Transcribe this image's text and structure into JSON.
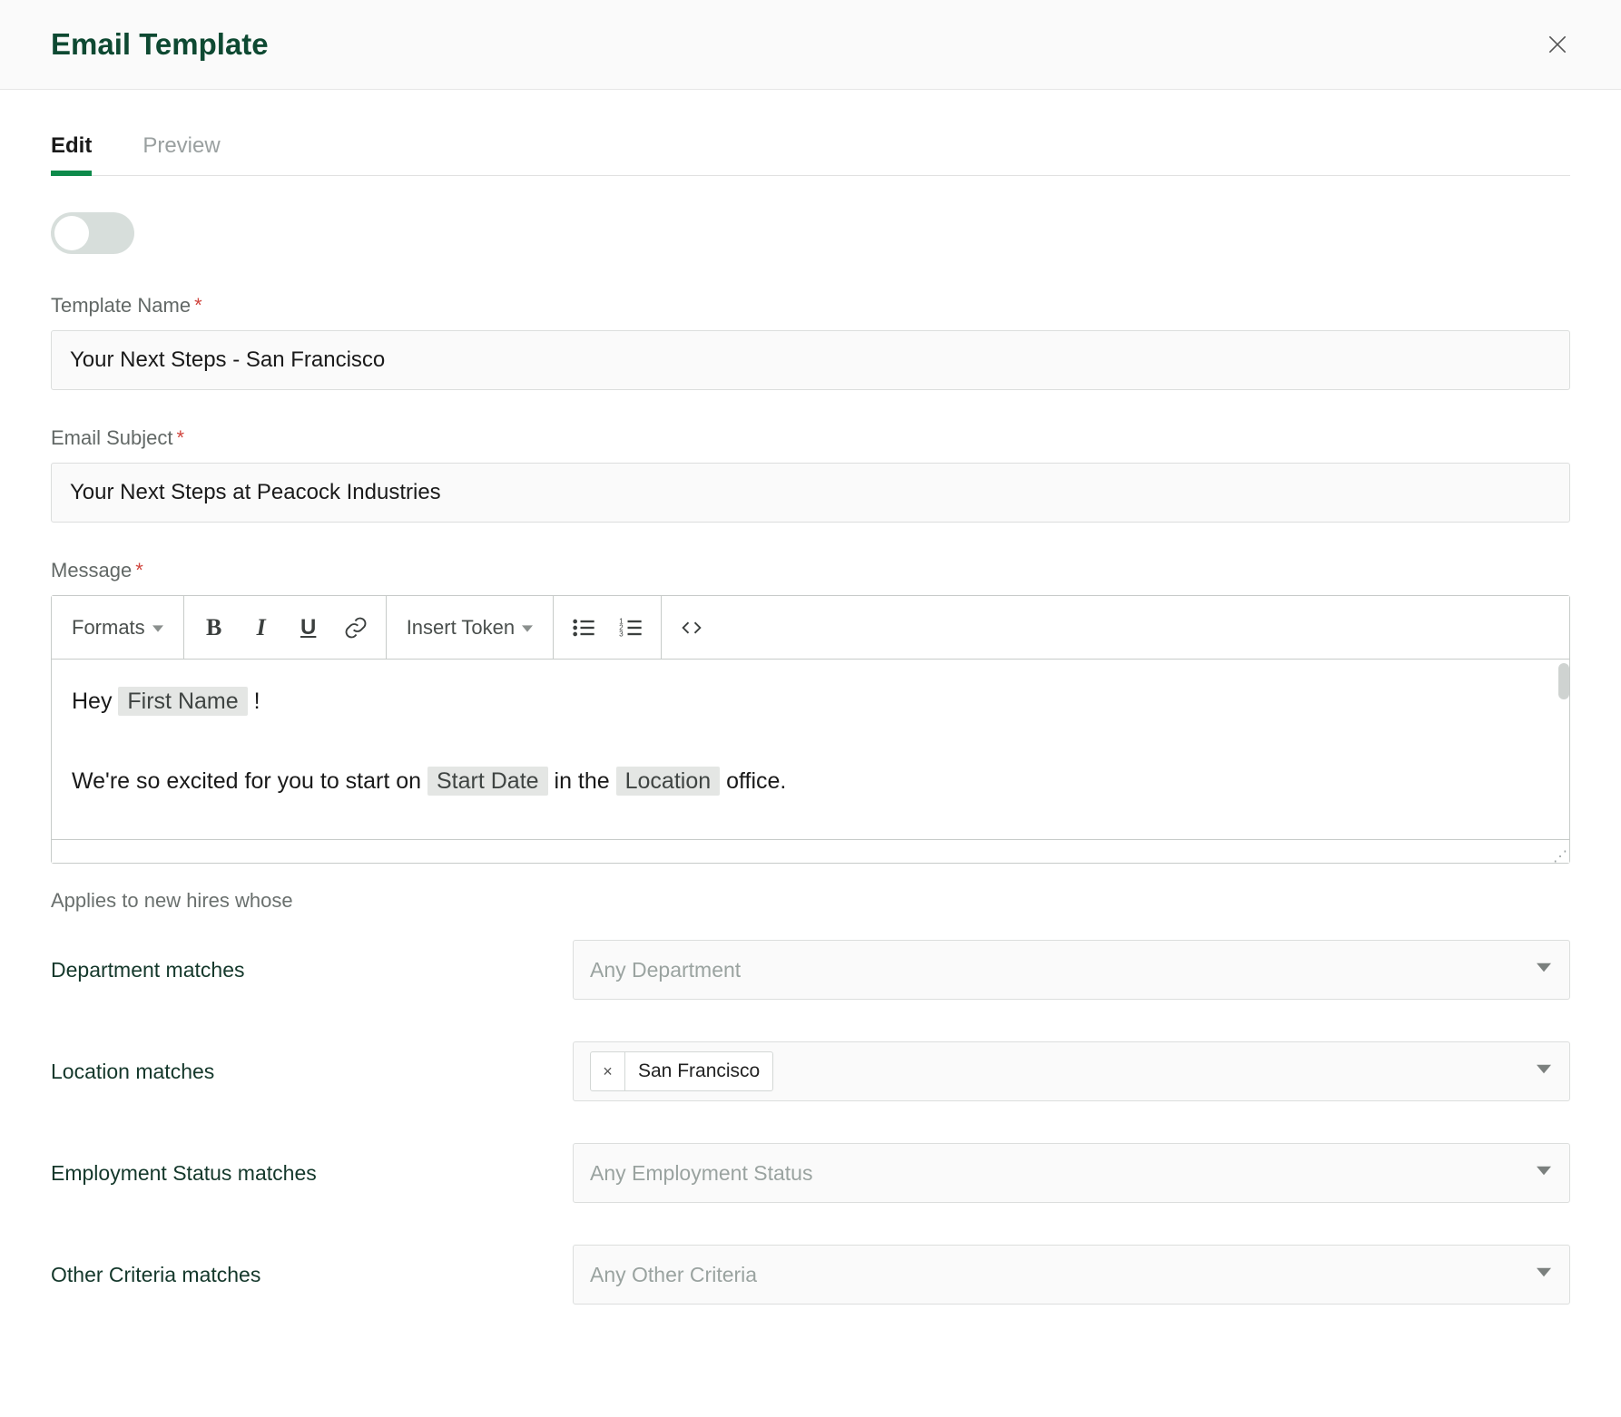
{
  "header": {
    "title": "Email Template"
  },
  "tabs": {
    "edit": "Edit",
    "preview": "Preview"
  },
  "labels": {
    "template_name": "Template Name",
    "email_subject": "Email Subject",
    "message": "Message",
    "applies_to": "Applies to new hires whose",
    "department": "Department matches",
    "location": "Location matches",
    "employment_status": "Employment Status matches",
    "other_criteria": "Other Criteria matches"
  },
  "values": {
    "template_name": "Your Next Steps - San Francisco",
    "email_subject": "Your Next Steps at Peacock Industries"
  },
  "toolbar": {
    "formats": "Formats",
    "insert_token": "Insert Token"
  },
  "message_parts": {
    "hey": "Hey ",
    "token_first_name": "First Name",
    "bang": " !",
    "line2a": "We're so excited for you to start on ",
    "token_start_date": "Start Date",
    "line2b": " in the ",
    "token_location": "Location",
    "line2c": " office."
  },
  "selects": {
    "department_placeholder": "Any Department",
    "employment_status_placeholder": "Any Employment Status",
    "other_criteria_placeholder": "Any Other Criteria",
    "location_chip": "San Francisco"
  }
}
